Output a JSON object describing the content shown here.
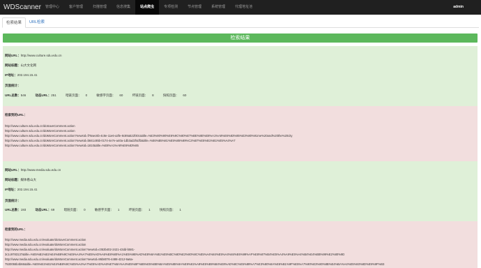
{
  "app": {
    "brand": "WDScanner",
    "nav": [
      "管理中心",
      "客户管理",
      "扫描管理",
      "信息搜集",
      "站点爬虫",
      "专项检测",
      "节点管理",
      "系统管理",
      "代理地址池"
    ],
    "active_nav": "站点爬虫",
    "user": "admin"
  },
  "tabs": [
    "检索结果",
    "URL检索"
  ],
  "result_title": "检索结果",
  "labels": {
    "site_url": "网站URL：",
    "site_title": "网站标题：",
    "ip": "IP地址：",
    "page_stats": "页面统计：",
    "url_total": "URL总数：",
    "dynamic_url": "动态URL：",
    "dark_page": "暗链页面：",
    "sensitive_page": "敏感字页面：",
    "bad_link_page": "坏链页面：",
    "snapshot_page": "快照页面：",
    "detected_url": "检索到的URL："
  },
  "sites": [
    {
      "url": "http://www.culture.sdu.edu.cn",
      "title": "山大文化网",
      "ip": "202.194.15.41",
      "url_total": "546",
      "dynamic_url": "251",
      "dark_page": "0",
      "sensitive_page": "60",
      "bad_link_page": "8",
      "snapshot_page": "60",
      "detected_urls": [
        "http://www.culture.sdu.edu.cn/doSaveComment.action",
        "http://www.culture.sdu.edu.cn/doMoreComment.action",
        "http://www.culture.sdu.edu.cn/doMoreComment.action?newsId=f79aec6b-4c8e-11e6-a3fe-8c89a522f40c&title=%E3%80%90%E6%9C%80%E7%BE%8E%E8%A1%A8%E6%83%85%E3%80%91me%20and%20the%20city",
        "http://www.culture.sdu.edu.cn/doMoreComment.action?newsId=b841c85b-0174-4e7e-a40a-1db3ad2f4df3&title=%E6%B5%81%E5%85%89%C2%B7%E5%B1%B1%E5%A4%A7",
        "http://www.culture.sdu.edu.cn/doMoreComment.action?newsId=1810&title=%E8%A1%A8%E6%83%85"
      ]
    },
    {
      "url": "http://www.media.sdu.edu.cn",
      "title": "媒体看山大",
      "ip": "202.194.15.41",
      "url_total": "193",
      "dynamic_url": "69",
      "dark_page": "0",
      "sensitive_page": "1",
      "bad_link_page": "1",
      "snapshot_page": "1",
      "detected_urls": [
        "http://www.media.sdu.edu.cn/evaluate/doSaveComment.action",
        "http://www.media.sdu.edu.cn/evaluate/doMoreComment.action",
        "http://www.media.sdu.edu.cn/evaluate/doMoreComment.action?newsId=c053b402-2421-43dd-b581-",
        "3c1c9783137&title=%E5%B1%B1%E4%B8%9C%E5%A4%A7%E5%AD%A6%E8%80%A1%E5%9B%AD%E8%8A%B1%E5%BC%80%E2%80%9C%E5%A4%84%E5%A4%84%E6%99%AF%E8%87%B4%E5%A4%A9%E5%A4%B4%E4%BB%99%E2%80%9D",
        "http://www.media.sdu.edu.cn/evaluate/doMoreComment.action?newsId=95b8076-4488-4212-9a6a-",
        "7530055b4b66&title=%E5%B1%B1%E4%B8%9C%E5%A4%A7%E5%AD%A6%E7%BA%A4%E5%BF%B5%E5%BB%BA%E5%85%9A%E9%81%A8%E5%B9%B4%E8%AD%8C%E5%89%A7%E3%80%8A%E6%B1%9F%E5%A7%90%E3%80%8B%E4%BA%A4%E5%93%8D%E9%9F%B3"
      ]
    }
  ]
}
